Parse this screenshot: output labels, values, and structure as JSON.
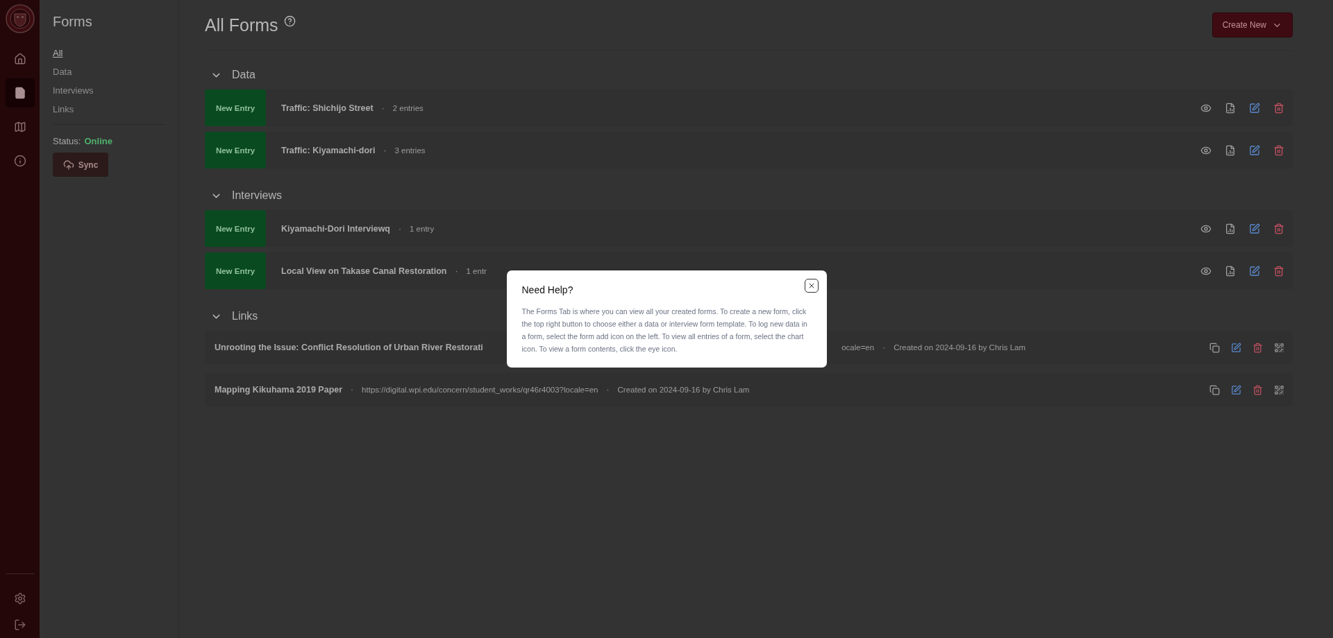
{
  "rail": {
    "items": [
      {
        "kind": "home",
        "selected": false
      },
      {
        "kind": "forms",
        "selected": true
      },
      {
        "kind": "map",
        "selected": false
      },
      {
        "kind": "info",
        "selected": false
      }
    ],
    "bottom_items": [
      {
        "kind": "settings"
      },
      {
        "kind": "logout"
      }
    ]
  },
  "sidebar": {
    "title": "Forms",
    "filters": [
      {
        "label": "All",
        "selected": true
      },
      {
        "label": "Data",
        "selected": false
      },
      {
        "label": "Interviews",
        "selected": false
      },
      {
        "label": "Links",
        "selected": false
      }
    ],
    "status_label": "Status:",
    "status_value": "Online",
    "sync_button": "Sync"
  },
  "header": {
    "title": "All Forms",
    "create_button": "Create New"
  },
  "sections": [
    {
      "title": "Data",
      "kind": "forms",
      "expanded": true,
      "rows": [
        {
          "button": "New Entry",
          "name": "Traffic: Shichijo Street",
          "separator": "·",
          "entries": "2 entries"
        },
        {
          "button": "New Entry",
          "name": "Traffic: Kiyamachi-dori",
          "separator": "·",
          "entries": "3 entries"
        }
      ]
    },
    {
      "title": "Interviews",
      "kind": "forms",
      "expanded": true,
      "rows": [
        {
          "button": "New Entry",
          "name": "Kiyamachi-Dori Interviewq",
          "separator": "·",
          "entries": "1 entry"
        },
        {
          "button": "New Entry",
          "name": "Local View on Takase Canal Restoration",
          "separator": "·",
          "entries": "1 entr"
        }
      ]
    },
    {
      "title": "Links",
      "kind": "links",
      "expanded": true,
      "rows": [
        {
          "title": "Unrooting the Issue: Conflict Resolution of Urban River Restorati",
          "url": "ocale=en",
          "separator": "·",
          "created": "Created on 2024-09-16 by Chris Lam",
          "covered": true
        },
        {
          "title": "Mapping Kikuhama 2019 Paper",
          "separator_1": "·",
          "url": "https://digital.wpi.edu/concern/student_works/qr46r4003?locale=en",
          "separator": "·",
          "created": "Created on 2024-09-16 by Chris Lam",
          "covered": false
        }
      ]
    }
  ],
  "dialog": {
    "title": "Need Help?",
    "text": "The Forms Tab is where you can view all your created forms. To create a new form, click the top right button to choose either a data or interview form template. To log new data in a form, select the form add icon on the left. To view all entries of a form, select the chart icon. To view a form contents, click the eye icon."
  }
}
